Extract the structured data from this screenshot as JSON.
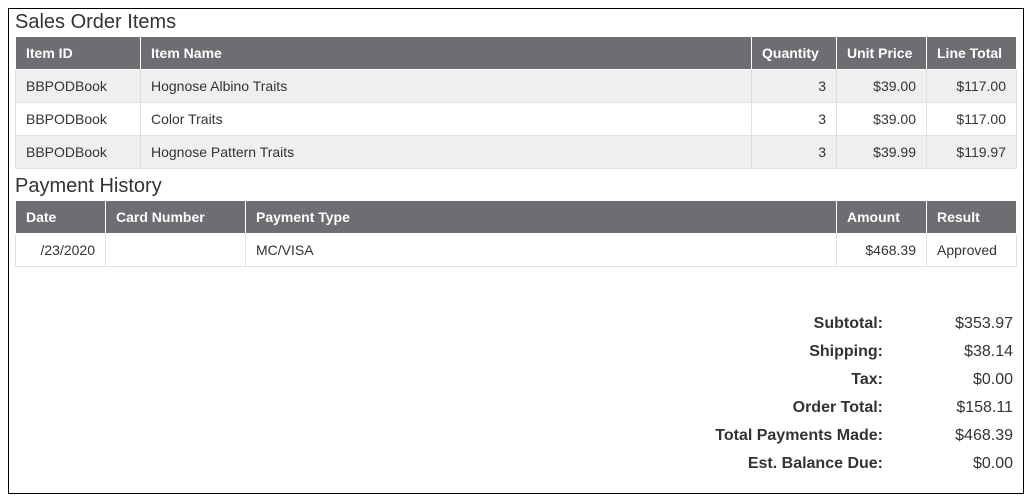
{
  "sections": {
    "items_title": "Sales Order Items",
    "payments_title": "Payment History"
  },
  "items_table": {
    "headers": {
      "item_id": "Item ID",
      "item_name": "Item Name",
      "quantity": "Quantity",
      "unit_price": "Unit Price",
      "line_total": "Line Total"
    },
    "rows": [
      {
        "item_id": "BBPODBook",
        "item_name": "Hognose Albino Traits",
        "quantity": "3",
        "unit_price": "$39.00",
        "line_total": "$117.00"
      },
      {
        "item_id": "BBPODBook",
        "item_name": "Color Traits",
        "quantity": "3",
        "unit_price": "$39.00",
        "line_total": "$117.00"
      },
      {
        "item_id": "BBPODBook",
        "item_name": "Hognose Pattern Traits",
        "quantity": "3",
        "unit_price": "$39.99",
        "line_total": "$119.97"
      }
    ]
  },
  "payments_table": {
    "headers": {
      "date": "Date",
      "card_number": "Card Number",
      "payment_type": "Payment Type",
      "amount": "Amount",
      "result": "Result"
    },
    "rows": [
      {
        "date": "/23/2020",
        "card_number": "",
        "payment_type": "MC/VISA",
        "amount": "$468.39",
        "result": "Approved"
      }
    ]
  },
  "totals": {
    "subtotal": {
      "label": "Subtotal:",
      "value": "$353.97"
    },
    "shipping": {
      "label": "Shipping:",
      "value": "$38.14"
    },
    "tax": {
      "label": "Tax:",
      "value": "$0.00"
    },
    "order_total": {
      "label": "Order Total:",
      "value": "$158.11"
    },
    "payments_made": {
      "label": "Total Payments Made:",
      "value": "$468.39"
    },
    "balance_due": {
      "label": "Est. Balance Due:",
      "value": "$0.00"
    }
  }
}
